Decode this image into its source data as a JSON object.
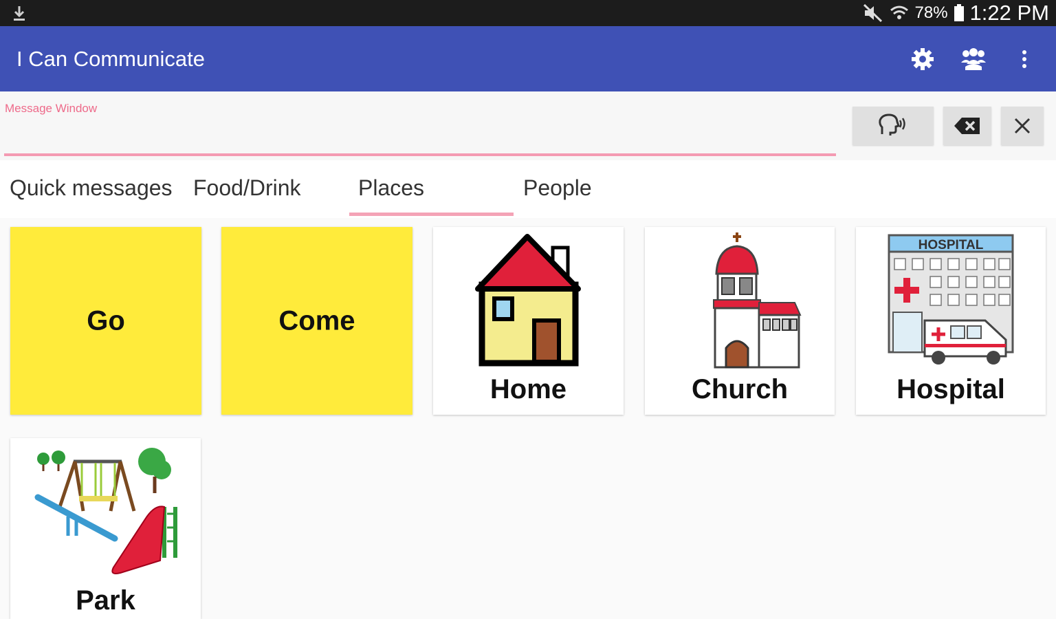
{
  "status_bar": {
    "battery": "78%",
    "time": "1:22 PM",
    "icons": [
      "download-icon",
      "mute-icon",
      "wifi-icon",
      "battery-icon"
    ]
  },
  "app_bar": {
    "title": "I Can Communicate",
    "actions": [
      "settings-icon",
      "people-icon",
      "overflow-menu-icon"
    ],
    "color": "#3f51b5"
  },
  "message_window": {
    "label": "Message Window",
    "value": "",
    "buttons": [
      "speak-icon",
      "backspace-icon",
      "close-icon"
    ]
  },
  "tabs": {
    "items": [
      {
        "label": "Quick messages"
      },
      {
        "label": "Food/Drink"
      },
      {
        "label": "Places"
      },
      {
        "label": "People"
      }
    ],
    "selected": "Places",
    "indicator_color": "#f4a3b6"
  },
  "tiles": [
    {
      "label": "Go",
      "style": "yellow"
    },
    {
      "label": "Come",
      "style": "yellow"
    },
    {
      "label": "Home",
      "icon": "house-icon"
    },
    {
      "label": "Church",
      "icon": "church-icon"
    },
    {
      "label": "Hospital",
      "icon": "hospital-icon",
      "sign_text": "HOSPITAL"
    },
    {
      "label": "Park",
      "icon": "playground-icon"
    }
  ],
  "colors": {
    "tile_yellow": "#ffeb3b",
    "accent_pink": "#ee6a8a"
  }
}
